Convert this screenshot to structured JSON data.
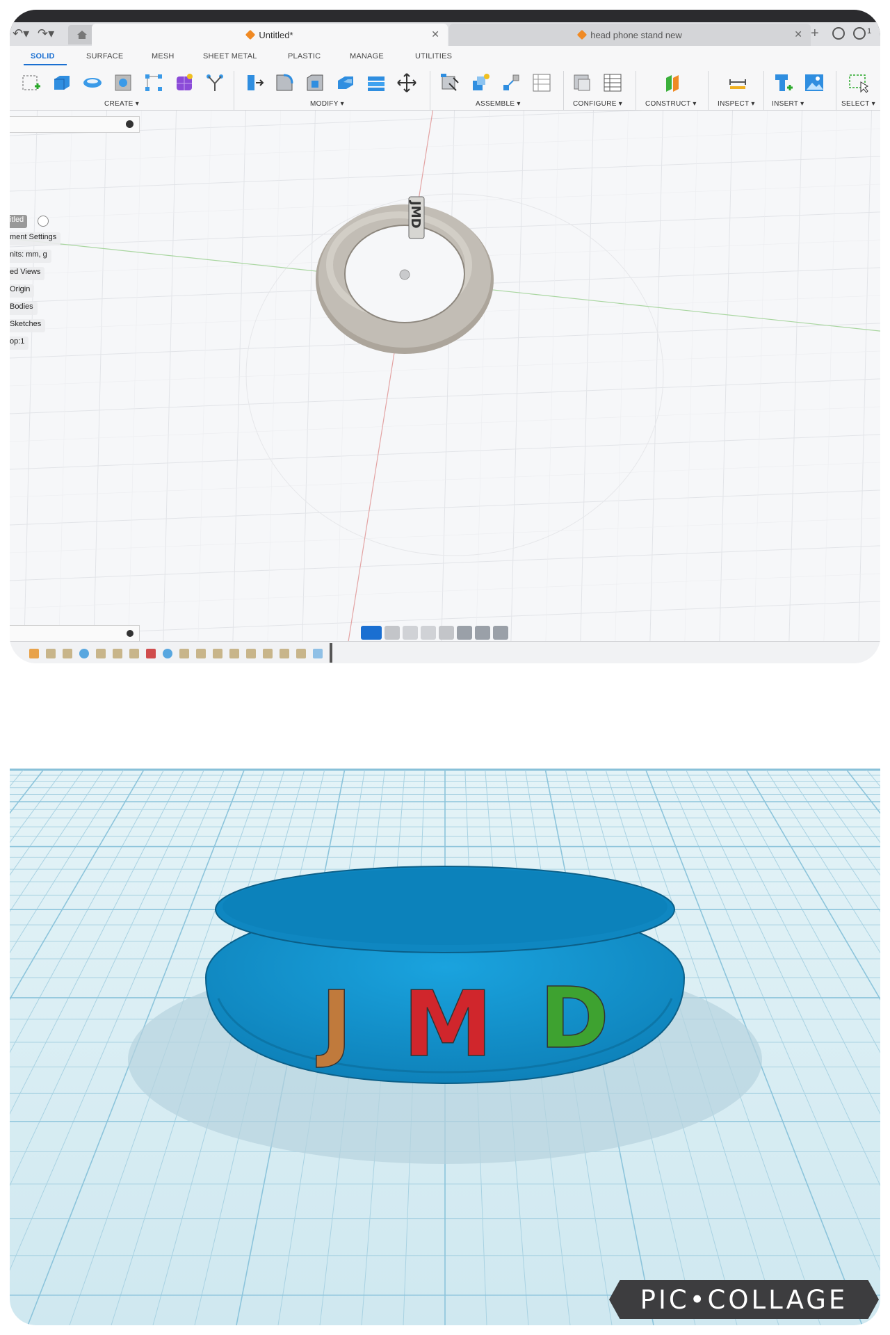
{
  "app": {
    "tabs": [
      {
        "label": "Untitled*",
        "active": true
      },
      {
        "label": "head phone stand new",
        "active": false
      }
    ],
    "job_count": "1",
    "ribbon_tabs": [
      "SOLID",
      "SURFACE",
      "MESH",
      "SHEET METAL",
      "PLASTIC",
      "MANAGE",
      "UTILITIES"
    ],
    "groups": [
      "CREATE ▾",
      "MODIFY ▾",
      "ASSEMBLE ▾",
      "CONFIGURE ▾",
      "CONSTRUCT ▾",
      "INSPECT ▾",
      "INSERT ▾",
      "SELECT ▾"
    ],
    "browser": {
      "root": "itled",
      "items": [
        "ment Settings",
        "nits: mm, g",
        "ed Views",
        "Origin",
        "Bodies",
        "Sketches",
        "op:1"
      ]
    },
    "model_text": "JMD"
  },
  "render": {
    "letters": [
      {
        "char": "J",
        "color": "#c07a3c"
      },
      {
        "char": "M",
        "color": "#d0262c"
      },
      {
        "char": "D",
        "color": "#3ea230"
      }
    ],
    "ring_color": "#1393d0"
  },
  "watermark": "PIC•COLLAGE"
}
